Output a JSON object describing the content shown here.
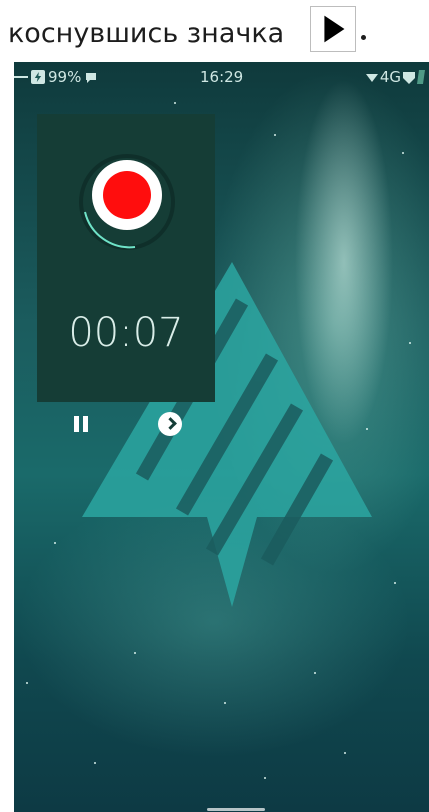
{
  "caption": {
    "text": "коснувшись значка",
    "icon": "play-icon"
  },
  "status_bar": {
    "battery": "99%",
    "time": "16:29",
    "network": "4G",
    "icons": [
      "charging-icon",
      "battery-icon",
      "notification-icon",
      "wifi-icon",
      "signal-icon",
      "sim-icon"
    ]
  },
  "recorder": {
    "elapsed": "00:07",
    "record_icon": "record-icon",
    "pause_icon": "pause-icon",
    "next_icon": "chevron-right-icon",
    "record_color": "#ff0d0d"
  },
  "colors": {
    "panel": "#153d36",
    "wallpaper": "#1b5c5e",
    "logo": "#2ca6a1"
  }
}
